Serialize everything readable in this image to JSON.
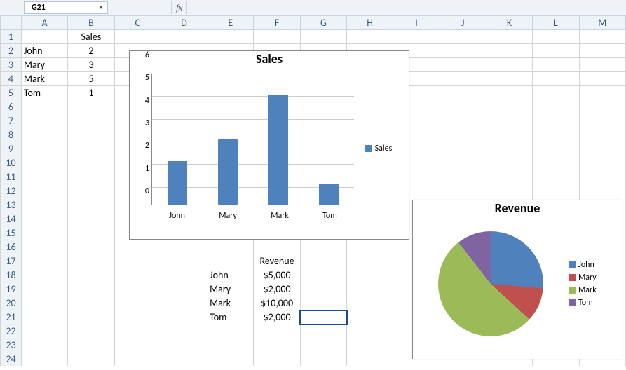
{
  "formula_bar": {
    "name_box_value": "G21",
    "fx_label": "fx",
    "formula_value": ""
  },
  "columns": [
    "A",
    "B",
    "C",
    "D",
    "E",
    "F",
    "G",
    "H",
    "I",
    "J",
    "K",
    "L",
    "M"
  ],
  "rows": 24,
  "cells": {
    "B1": "Sales",
    "A2": "John",
    "B2": "2",
    "A3": "Mary",
    "B3": "3",
    "A4": "Mark",
    "B4": "5",
    "A5": "Tom",
    "B5": "1",
    "F17": "Revenue",
    "E18": "John",
    "F18": "$5,000",
    "E19": "Mary",
    "F19": "$2,000",
    "E20": "Mark",
    "F20": "$10,000",
    "E21": "Tom",
    "F21": "$2,000"
  },
  "selected_cell": "G21",
  "colors": {
    "bar": "#4f81bd",
    "pie": [
      "#4f81bd",
      "#c0504d",
      "#9bbb59",
      "#8064a2"
    ]
  },
  "chart_data": [
    {
      "type": "bar",
      "title": "Sales",
      "categories": [
        "John",
        "Mary",
        "Mark",
        "Tom"
      ],
      "series": [
        {
          "name": "Sales",
          "values": [
            2,
            3,
            5,
            1
          ]
        }
      ],
      "ylim": [
        0,
        6
      ],
      "yticks": [
        0,
        1,
        2,
        3,
        4,
        5,
        6
      ],
      "xlabel": "",
      "ylabel": ""
    },
    {
      "type": "pie",
      "title": "Revenue",
      "categories": [
        "John",
        "Mary",
        "Mark",
        "Tom"
      ],
      "values": [
        5000,
        2000,
        10000,
        2000
      ]
    }
  ]
}
